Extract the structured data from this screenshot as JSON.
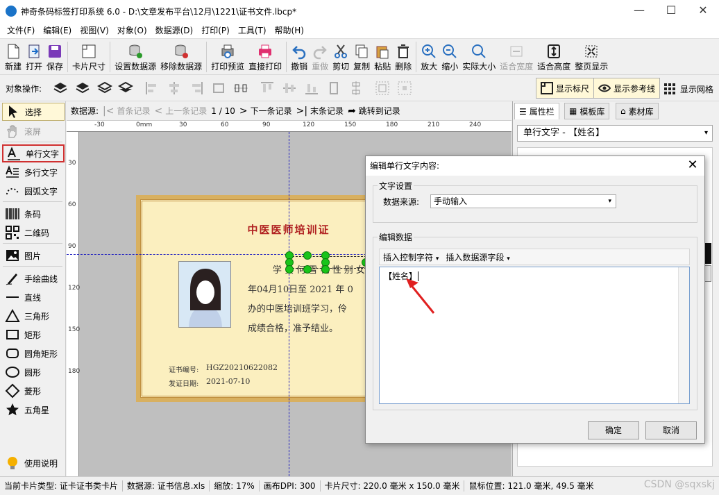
{
  "window": {
    "title": "神奇条码标签打印系统 6.0 - D:\\文章发布平台\\12月\\1221\\证书文件.lbcp*",
    "min": "—",
    "max": "☐",
    "close": "✕"
  },
  "menu": [
    "文件(F)",
    "编辑(E)",
    "视图(V)",
    "对象(O)",
    "数据源(D)",
    "打印(P)",
    "工具(T)",
    "帮助(H)"
  ],
  "toolbar": {
    "new": "新建",
    "open": "打开",
    "save": "保存",
    "card_size": "卡片尺寸",
    "set_ds": "设置数据源",
    "rm_ds": "移除数据源",
    "preview": "打印预览",
    "print": "直接打印",
    "undo": "撤销",
    "redo": "重做",
    "cut": "剪切",
    "copy": "复制",
    "paste": "粘贴",
    "delete": "删除",
    "zoom_in": "放大",
    "zoom_out": "缩小",
    "actual": "实际大小",
    "fit_width": "适合宽度",
    "fit_height": "适合高度",
    "fit_page": "整页显示"
  },
  "objbar": {
    "label": "对象操作:",
    "show_ruler": "显示标尺",
    "show_guides": "显示参考线",
    "show_grid": "显示网格"
  },
  "tools": {
    "select": "选择",
    "scroll": "滚屏",
    "single_text": "单行文字",
    "multi_text": "多行文字",
    "arc_text": "圆弧文字",
    "barcode": "条码",
    "qrcode": "二维码",
    "image": "图片",
    "freehand": "手绘曲线",
    "line": "直线",
    "triangle": "三角形",
    "rect": "矩形",
    "roundrect": "圆角矩形",
    "ellipse": "圆形",
    "diamond": "菱形",
    "star": "五角星",
    "help": "使用说明"
  },
  "nav": {
    "label": "数据源:",
    "first": "首条记录",
    "prev": "上一条记录",
    "position": "1 / 10",
    "next": "下一条记录",
    "last": "末条记录",
    "goto": "跳转到记录"
  },
  "ruler": {
    "top": [
      "-30",
      "0mm",
      "30",
      "60",
      "90",
      "120",
      "150",
      "180",
      "210",
      "240"
    ],
    "left": [
      "30",
      "60",
      "90",
      "120",
      "150",
      "180"
    ]
  },
  "cert": {
    "title": "中医医师培训证",
    "line1": "学 员 何 雪 艳  性 别 女",
    "line2": "年04月10日至 2021 年 0",
    "line3": "办的中医培训班学习，伶",
    "line4": "成绩合格，准予结业。",
    "no_label": "证书编号:",
    "no_value": "HGZ20210622082",
    "date_label": "发证日期:",
    "date_value": "2021-07-10"
  },
  "right": {
    "tab_props": "属性栏",
    "tab_templates": "模板库",
    "tab_assets": "素材库",
    "selected": "单行文字 - 【姓名】"
  },
  "status": {
    "card_type": "当前卡片类型: 证卡证书类卡片",
    "datasource": "数据源: 证书信息.xls",
    "zoom": "缩放: 17%",
    "dpi": "画布DPI: 300",
    "card_size": "卡片尺寸: 220.0 毫米 x 150.0 毫米",
    "mouse": "鼠标位置: 121.0 毫米, 49.5 毫米",
    "watermark": "CSDN @sqxskj"
  },
  "dialog": {
    "title": "编辑单行文字内容:",
    "group_text": "文字设置",
    "src_label": "数据来源:",
    "src_value": "手动输入",
    "group_edit": "编辑数据",
    "insert_ctrl": "插入控制字符",
    "insert_field": "插入数据源字段",
    "content": "【姓名】",
    "ok": "确定",
    "cancel": "取消"
  },
  "colors": {
    "accent": "#b02020",
    "select_green": "#19c419",
    "arrow_red": "#e02020"
  }
}
